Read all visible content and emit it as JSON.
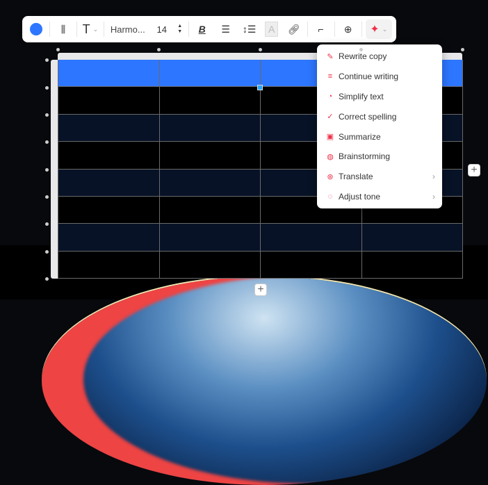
{
  "toolbar": {
    "font_name": "Harmo...",
    "font_size": "14",
    "color": "#2d76ff"
  },
  "menu": {
    "items": [
      {
        "label": "Rewrite copy",
        "icon": "magic-wand-icon",
        "submenu": false
      },
      {
        "label": "Continue writing",
        "icon": "lines-icon",
        "submenu": false
      },
      {
        "label": "Simplify text",
        "icon": "simplify-icon",
        "submenu": false
      },
      {
        "label": "Correct spelling",
        "icon": "spell-check-icon",
        "submenu": false
      },
      {
        "label": "Summarize",
        "icon": "summarize-icon",
        "submenu": false
      },
      {
        "label": "Brainstorming",
        "icon": "brain-icon",
        "submenu": false
      },
      {
        "label": "Translate",
        "icon": "translate-icon",
        "submenu": true
      },
      {
        "label": "Adjust tone",
        "icon": "tone-icon",
        "submenu": true
      }
    ]
  },
  "table": {
    "rows": 8,
    "cols": 4,
    "header_color": "#2d76ff",
    "stripe_color": "#071226"
  }
}
